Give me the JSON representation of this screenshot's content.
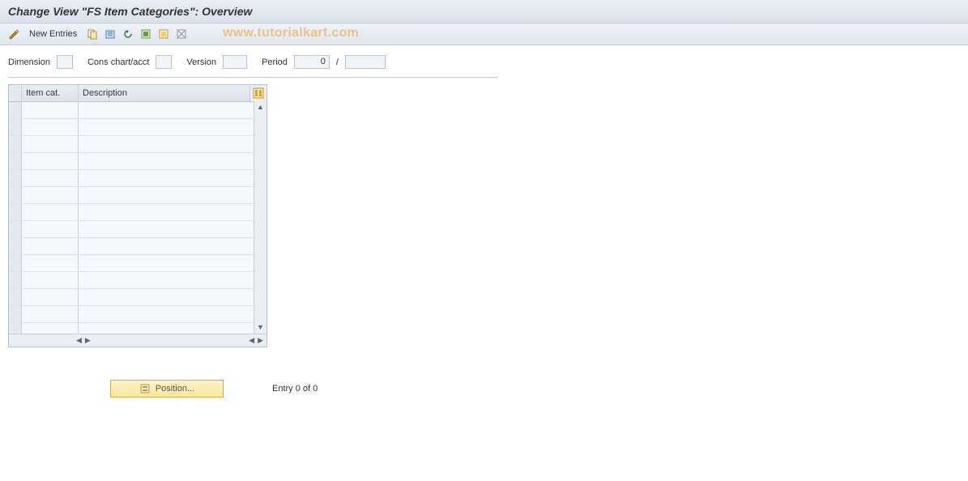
{
  "title": "Change View \"FS Item Categories\": Overview",
  "watermark": "www.tutorialkart.com",
  "toolbar": {
    "new_entries_label": "New Entries"
  },
  "filters": {
    "dimension_label": "Dimension",
    "dimension_value": "",
    "cons_label": "Cons chart/acct",
    "cons_value": "",
    "version_label": "Version",
    "version_value": "",
    "period_label": "Period",
    "period_value": "0",
    "period_sep": "/",
    "period_year": ""
  },
  "grid": {
    "col_item": "Item cat.",
    "col_desc": "Description",
    "rows": [
      {
        "item": "",
        "desc": ""
      },
      {
        "item": "",
        "desc": ""
      },
      {
        "item": "",
        "desc": ""
      },
      {
        "item": "",
        "desc": ""
      },
      {
        "item": "",
        "desc": ""
      },
      {
        "item": "",
        "desc": ""
      },
      {
        "item": "",
        "desc": ""
      },
      {
        "item": "",
        "desc": ""
      },
      {
        "item": "",
        "desc": ""
      },
      {
        "item": "",
        "desc": ""
      },
      {
        "item": "",
        "desc": ""
      },
      {
        "item": "",
        "desc": ""
      },
      {
        "item": "",
        "desc": ""
      },
      {
        "item": "",
        "desc": ""
      }
    ]
  },
  "footer": {
    "position_label": "Position...",
    "entry_label": "Entry 0 of 0"
  }
}
